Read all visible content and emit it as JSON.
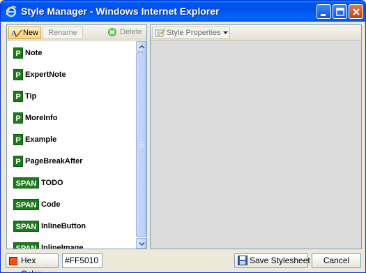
{
  "window": {
    "title": "Style Manager - Windows Internet Explorer",
    "icon": "internet-explorer-icon"
  },
  "left_toolbar": {
    "new_label": "New",
    "rename_label": "Rename",
    "delete_label": "Delete"
  },
  "styles": [
    {
      "type": "P",
      "name": "Note"
    },
    {
      "type": "P",
      "name": "ExpertNote"
    },
    {
      "type": "P",
      "name": "Tip"
    },
    {
      "type": "P",
      "name": "MoreInfo"
    },
    {
      "type": "P",
      "name": "Example"
    },
    {
      "type": "P",
      "name": "PageBreakAfter"
    },
    {
      "type": "SPAN",
      "name": "TODO"
    },
    {
      "type": "SPAN",
      "name": "Code"
    },
    {
      "type": "SPAN",
      "name": "InlineButton"
    },
    {
      "type": "SPAN",
      "name": "InlineImage"
    }
  ],
  "right_toolbar": {
    "style_properties_label": "Style Properties"
  },
  "footer": {
    "hex_color_label": "Hex Color",
    "hex_value": "#FF5010",
    "save_label": "Save Stylesheet",
    "cancel_label": "Cancel"
  },
  "colors": {
    "badge_green": "#1d7a1d",
    "swatch": "#ff5010"
  }
}
